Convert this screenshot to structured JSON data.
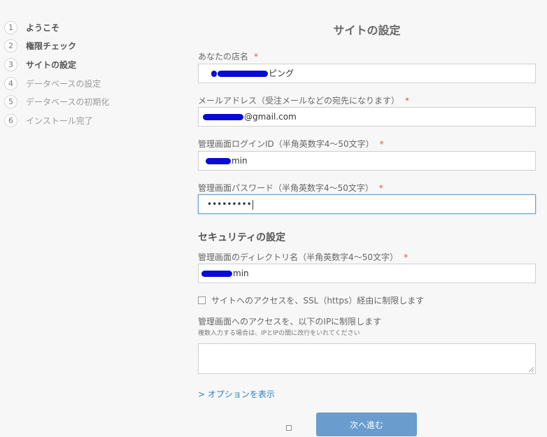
{
  "sidebar": {
    "steps": [
      {
        "num": "1",
        "label": "ようこそ"
      },
      {
        "num": "2",
        "label": "権限チェック"
      },
      {
        "num": "3",
        "label": "サイトの設定"
      },
      {
        "num": "4",
        "label": "データベースの設定"
      },
      {
        "num": "5",
        "label": "データベースの初期化"
      },
      {
        "num": "6",
        "label": "インストール完了"
      }
    ]
  },
  "main": {
    "title": "サイトの設定",
    "shop_name": {
      "label": "あなたの店名",
      "required": "*",
      "value": "ピング"
    },
    "email": {
      "label": "メールアドレス（受注メールなどの宛先になります）",
      "required": "*",
      "value": "@gmail.com"
    },
    "login_id": {
      "label": "管理画面ログインID（半角英数字4〜50文字）",
      "required": "*",
      "value": "min"
    },
    "password": {
      "label": "管理画面パスワード（半角英数字4〜50文字）",
      "required": "*",
      "value": "•••••••••"
    },
    "security_section": {
      "title": "セキュリティの設定"
    },
    "directory": {
      "label": "管理画面のディレクトリ名（半角英数字4〜50文字）",
      "required": "*",
      "value": "min"
    },
    "ssl_checkbox": {
      "label": "サイトへのアクセスを、SSL（https）経由に制限します",
      "checked": false
    },
    "ip_restrict": {
      "label": "管理画面へのアクセスを、以下のIPに制限します",
      "help": "複数入力する場合は、IPとIPの間に改行をいれてください",
      "value": ""
    },
    "options_link": "> オプションを表示",
    "next_button": "次へ進む"
  },
  "colors": {
    "accent": "#6a9ccd",
    "link": "#2f7fbf",
    "required": "#d9534f",
    "redaction": "#0a0ad6"
  }
}
